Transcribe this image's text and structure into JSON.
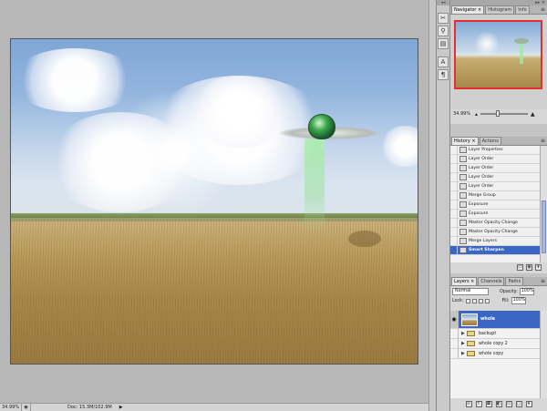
{
  "status": {
    "zoom": "34.99%",
    "doc": "Doc: 15.3M/102.9M"
  },
  "toolstrip": {
    "icons": [
      "brush-preset-icon",
      "clone-source-icon",
      "tool-presets-icon",
      "character-icon",
      "paragraph-icon"
    ]
  },
  "panel": {
    "collapse_glyph": "◂◂",
    "close_glyph": "▸▸ ✕"
  },
  "navigator": {
    "tabs": [
      {
        "label": "Navigator ×",
        "active": true
      },
      {
        "label": "Histogram",
        "active": false
      },
      {
        "label": "Info",
        "active": false
      }
    ],
    "zoom": "34.99%",
    "slider_position": 0.35
  },
  "history": {
    "tabs": [
      {
        "label": "History ×",
        "active": true
      },
      {
        "label": "Actions",
        "active": false
      }
    ],
    "items": [
      {
        "label": "Layer Properties"
      },
      {
        "label": "Layer Order"
      },
      {
        "label": "Layer Order"
      },
      {
        "label": "Layer Order"
      },
      {
        "label": "Layer Order"
      },
      {
        "label": "Merge Group"
      },
      {
        "label": "Exposure"
      },
      {
        "label": "Exposure"
      },
      {
        "label": "Master Opacity Change"
      },
      {
        "label": "Master Opacity Change"
      },
      {
        "label": "Merge Layers"
      },
      {
        "label": "Smart Sharpen"
      }
    ],
    "selected_index": 11
  },
  "layers": {
    "tabs": [
      {
        "label": "Layers ×",
        "active": true
      },
      {
        "label": "Channels",
        "active": false
      },
      {
        "label": "Paths",
        "active": false
      }
    ],
    "blend_mode": "Normal",
    "opacity_label": "Opacity:",
    "opacity": "100%",
    "lock_label": "Lock:",
    "fill_label": "Fill:",
    "fill": "100%",
    "items": [
      {
        "name": "whole",
        "type": "layer",
        "visible": true
      },
      {
        "name": "backupt",
        "type": "group",
        "visible": false
      },
      {
        "name": "whole copy 2",
        "type": "group",
        "visible": false
      },
      {
        "name": "whole copy",
        "type": "group",
        "visible": false
      }
    ]
  }
}
